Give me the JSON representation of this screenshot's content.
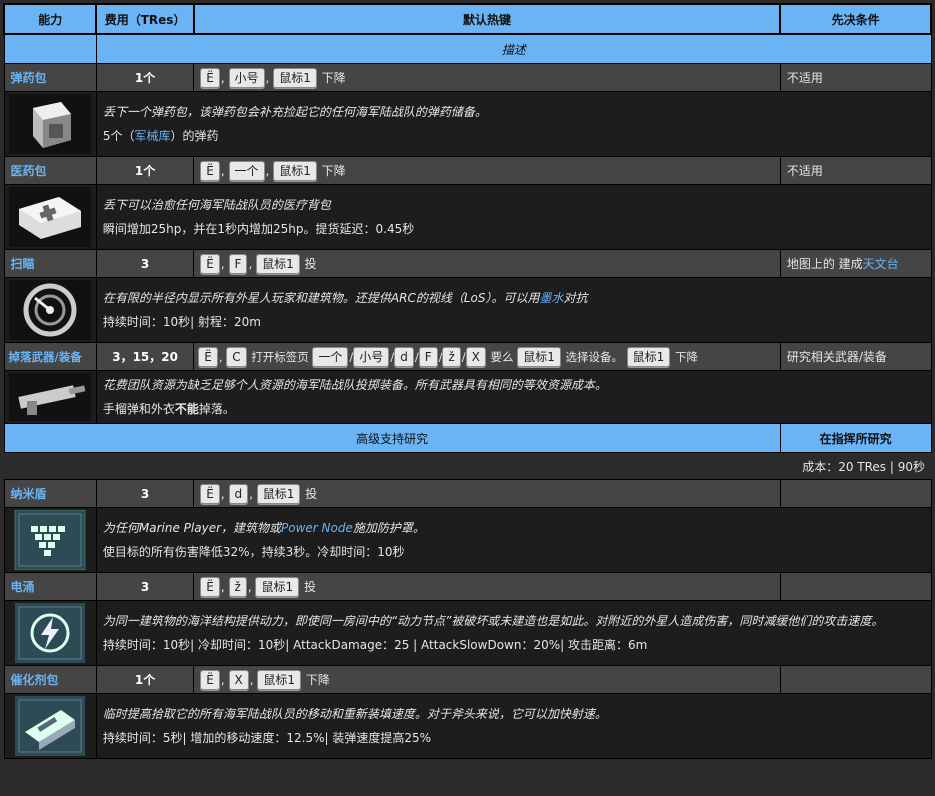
{
  "headers": {
    "ability": "能力",
    "cost": "费用（TRes）",
    "hotkey": "默认热键",
    "prereq": "先决条件",
    "description": "描述"
  },
  "abilities": [
    {
      "name": "弹药包",
      "cost": "1个",
      "keys": [
        "Ë",
        "小号",
        "鼠标1"
      ],
      "suffix": "下降",
      "prereq": "不适用",
      "desc1": "丢下一个弹药包，该弹药包会补充捡起它的任何海军陆战队的弹药储备。",
      "desc2_pre": "5个（",
      "desc2_link": "军械库",
      "desc2_post": "）的弹药",
      "icon": "ammo-pack-icon"
    },
    {
      "name": "医药包",
      "cost": "1个",
      "keys": [
        "Ë",
        "一个",
        "鼠标1"
      ],
      "suffix": "下降",
      "prereq": "不适用",
      "desc1": "丢下可以治愈任何海军陆战队员的医疗背包",
      "desc2": "瞬间增加25hp，并在1秒内增加25hp。提货延迟：0.45秒",
      "icon": "med-pack-icon"
    },
    {
      "name": "扫瞄",
      "cost": "3",
      "keys": [
        "Ë",
        "F",
        "鼠标1"
      ],
      "suffix": "投",
      "prereq_pre": "地图上的 建成",
      "prereq_link": "天文台",
      "desc1_pre": "在有限的半径内显示所有外星人玩家和建筑物。还提供ARC的视线（LoS）。可以用",
      "desc1_link": "墨水",
      "desc1_post": "对抗",
      "desc2": "持续时间：10秒| 射程：20m",
      "icon": "scan-icon"
    },
    {
      "name": "掉落武器/装备",
      "cost": "3，15，20",
      "keys1": [
        "Ë",
        "C"
      ],
      "mid1": "打开标签页",
      "keys2": [
        "一个",
        "小号",
        "d",
        "F",
        "ž",
        "X"
      ],
      "mid2": "要么",
      "keys3": [
        "鼠标1"
      ],
      "mid3": "选择设备。",
      "keys4": [
        "鼠标1"
      ],
      "suffix": "下降",
      "prereq": "研究相关武器/装备",
      "desc1": "花费团队资源为缺乏足够个人资源的海军陆战队投掷装备。所有武器具有相同的等效资源成本。",
      "desc2_pre": "手榴弹和外衣",
      "desc2_bold": "不能",
      "desc2_post": "掉落。",
      "icon": "weapon-drop-icon"
    }
  ],
  "category": {
    "title": "高级支持研究",
    "research": "在指挥所研究",
    "cost_line": "成本：20 TRes | 90秒"
  },
  "advanced": [
    {
      "name": "纳米盾",
      "cost": "3",
      "keys": [
        "Ë",
        "d",
        "鼠标1"
      ],
      "suffix": "投",
      "desc1_pre": "为任何Marine Player，建筑物或",
      "desc1_link": "Power Node",
      "desc1_post": "施加防护罩。",
      "desc2": "使目标的所有伤害降低32%，持续3秒。冷却时间：10秒",
      "icon": "nano-shield-icon"
    },
    {
      "name": "电涌",
      "cost": "3",
      "keys": [
        "Ë",
        "ž",
        "鼠标1"
      ],
      "suffix": "投",
      "desc1": "为同一建筑物的海洋结构提供动力，即使同一房间中的“动力节点”被破坏或未建造也是如此。对附近的外星人造成伤害，同时减缓他们的攻击速度。",
      "desc2": "持续时间：10秒| 冷却时间：10秒| AttackDamage：25 | AttackSlowDown：20%| 攻击距离：6m",
      "icon": "power-surge-icon"
    },
    {
      "name": "催化剂包",
      "cost": "1个",
      "keys": [
        "Ë",
        "X",
        "鼠标1"
      ],
      "suffix": "下降",
      "desc1": "临时提高拾取它的所有海军陆战队员的移动和重新装填速度。对于斧头来说，它可以加快射速。",
      "desc2": "持续时间：5秒| 增加的移动速度：12.5%| 装弹速度提高25%",
      "icon": "catalyst-pack-icon"
    }
  ]
}
